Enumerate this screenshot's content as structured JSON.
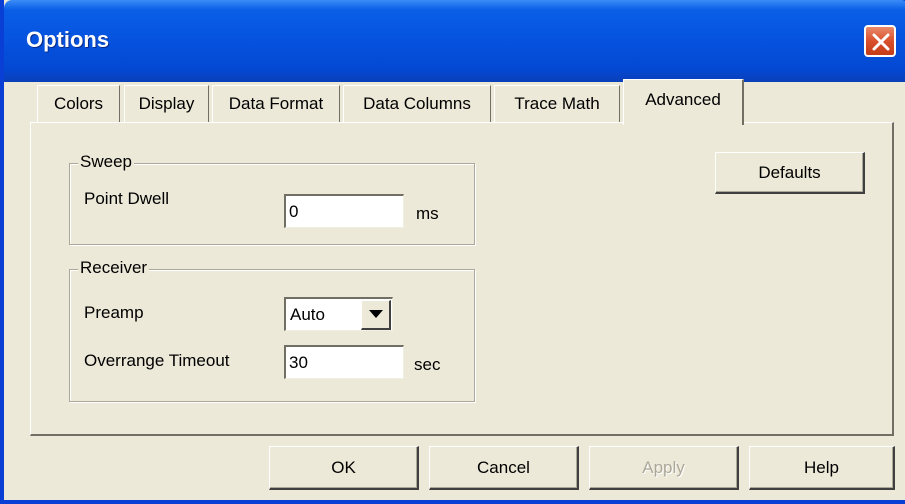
{
  "window": {
    "title": "Options"
  },
  "tabs": [
    {
      "label": "Colors",
      "active": false
    },
    {
      "label": "Display",
      "active": false
    },
    {
      "label": "Data Format",
      "active": false
    },
    {
      "label": "Data Columns",
      "active": false
    },
    {
      "label": "Trace Math",
      "active": false
    },
    {
      "label": "Advanced",
      "active": true
    }
  ],
  "sweep": {
    "title": "Sweep",
    "point_dwell_label": "Point Dwell",
    "point_dwell_value": "0",
    "point_dwell_unit": "ms"
  },
  "receiver": {
    "title": "Receiver",
    "preamp_label": "Preamp",
    "preamp_value": "Auto",
    "overrange_label": "Overrange Timeout",
    "overrange_value": "30",
    "overrange_unit": "sec"
  },
  "buttons": {
    "defaults": "Defaults",
    "ok": "OK",
    "cancel": "Cancel",
    "apply": "Apply",
    "help": "Help"
  },
  "colors": {
    "title_bar": "#0654e0",
    "close_button": "#d9502c",
    "dialog_bg": "#ece9d8"
  }
}
